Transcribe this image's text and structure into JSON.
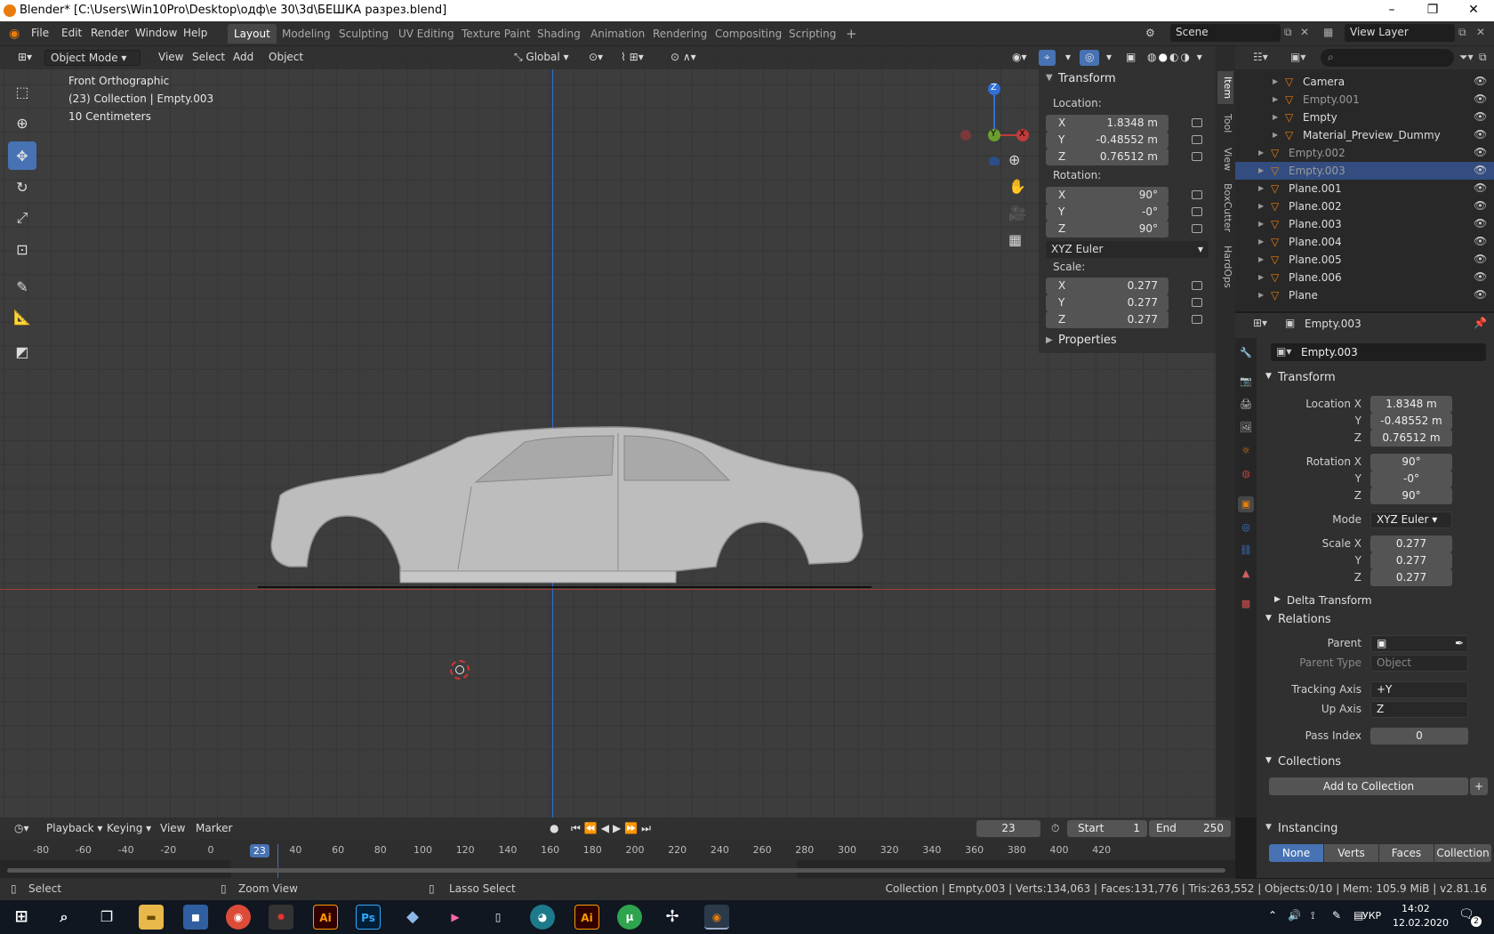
{
  "app": {
    "title": "Blender* [C:\\Users\\Win10Pro\\Desktop\\одф\\е 30\\3d\\БЕШКА разрез.blend]"
  },
  "menu": [
    "File",
    "Edit",
    "Render",
    "Window",
    "Help"
  ],
  "workspaces": [
    "Layout",
    "Modeling",
    "Sculpting",
    "UV Editing",
    "Texture Paint",
    "Shading",
    "Animation",
    "Rendering",
    "Compositing",
    "Scripting"
  ],
  "scene": "Scene",
  "view_layer": "View Layer",
  "viewport": {
    "mode": "Object Mode",
    "menus": [
      "View",
      "Select",
      "Add",
      "Object"
    ],
    "orientation": "Global",
    "overlay": {
      "view": "Front Orthographic",
      "collection": "(23) Collection | Empty.003",
      "scale": "10 Centimeters"
    },
    "gizmo": {
      "z": "Z",
      "y": "Y",
      "x": "X"
    }
  },
  "npanel": {
    "title": "Transform",
    "location_label": "Location:",
    "rotation_label": "Rotation:",
    "scale_label": "Scale:",
    "location": [
      {
        "axis": "X",
        "value": "1.8348 m"
      },
      {
        "axis": "Y",
        "value": "-0.48552 m"
      },
      {
        "axis": "Z",
        "value": "0.76512 m"
      }
    ],
    "rotation": [
      {
        "axis": "X",
        "value": "90°"
      },
      {
        "axis": "Y",
        "value": "-0°"
      },
      {
        "axis": "Z",
        "value": "90°"
      }
    ],
    "rotation_mode": "XYZ Euler",
    "scale": [
      {
        "axis": "X",
        "value": "0.277"
      },
      {
        "axis": "Y",
        "value": "0.277"
      },
      {
        "axis": "Z",
        "value": "0.277"
      }
    ],
    "properties": "Properties"
  },
  "sidetabs": [
    "Item",
    "Tool",
    "View",
    "BoxCutter",
    "HardOps"
  ],
  "outliner": [
    {
      "name": "Camera",
      "level": 2,
      "sel": false
    },
    {
      "name": "Empty.001",
      "level": 2,
      "sel": false
    },
    {
      "name": "Empty",
      "level": 2,
      "sel": false
    },
    {
      "name": "Material_Preview_Dummy",
      "level": 2,
      "sel": false
    },
    {
      "name": "Empty.002",
      "level": 1,
      "sel": false
    },
    {
      "name": "Empty.003",
      "level": 1,
      "sel": true
    },
    {
      "name": "Plane.001",
      "level": 1,
      "sel": false
    },
    {
      "name": "Plane.002",
      "level": 1,
      "sel": false
    },
    {
      "name": "Plane.003",
      "level": 1,
      "sel": false
    },
    {
      "name": "Plane.004",
      "level": 1,
      "sel": false
    },
    {
      "name": "Plane.005",
      "level": 1,
      "sel": false
    },
    {
      "name": "Plane.006",
      "level": 1,
      "sel": false
    },
    {
      "name": "Plane",
      "level": 1,
      "sel": false
    }
  ],
  "props": {
    "object": "Empty.003",
    "name_field": "Empty.003",
    "transform": "Transform",
    "loc_labels": [
      "Location X",
      "Y",
      "Z"
    ],
    "loc": [
      "1.8348 m",
      "-0.48552 m",
      "0.76512 m"
    ],
    "rot_labels": [
      "Rotation X",
      "Y",
      "Z"
    ],
    "rot": [
      "90°",
      "-0°",
      "90°"
    ],
    "mode_label": "Mode",
    "mode": "XYZ Euler",
    "scale_labels": [
      "Scale X",
      "Y",
      "Z"
    ],
    "scale": [
      "0.277",
      "0.277",
      "0.277"
    ],
    "delta": "Delta Transform",
    "relations": "Relations",
    "parent": "Parent",
    "parent_type": "Parent Type",
    "parent_type_val": "Object",
    "tracking": "Tracking Axis",
    "tracking_val": "+Y",
    "up": "Up Axis",
    "up_val": "Z",
    "pass": "Pass Index",
    "pass_val": "0",
    "collections": "Collections",
    "add_coll": "Add to Collection",
    "instancing": "Instancing",
    "inst_opts": [
      "None",
      "Verts",
      "Faces",
      "Collection"
    ]
  },
  "timeline": {
    "menus": [
      "Playback",
      "Keying",
      "View",
      "Marker"
    ],
    "frame": "23",
    "start_label": "Start",
    "start": "1",
    "end_label": "End",
    "end": "250",
    "ticks": [
      "-80",
      "-60",
      "-40",
      "-20",
      "0",
      "23",
      "40",
      "60",
      "80",
      "100",
      "120",
      "140",
      "160",
      "180",
      "200",
      "220",
      "240",
      "260",
      "280",
      "300",
      "320",
      "340",
      "360",
      "380",
      "400",
      "420"
    ]
  },
  "status": {
    "select": "Select",
    "zoom": "Zoom View",
    "lasso": "Lasso Select",
    "info": "Collection | Empty.003 | Verts:134,063 | Faces:131,776 | Tris:263,552 | Objects:0/10 | Mem: 105.9 MiB | v2.81.16"
  },
  "taskbar": {
    "lang": "УКР",
    "time": "14:02",
    "date": "12.02.2020",
    "notif": "2",
    "apps": [
      "Ai",
      "Ps",
      "Ai"
    ]
  },
  "colors": {
    "accent": "#4772b3",
    "selection": "#334d80",
    "x_axis": "#c03b3b",
    "y_axis": "#6b9f2f",
    "z_axis": "#2f6fd6"
  }
}
